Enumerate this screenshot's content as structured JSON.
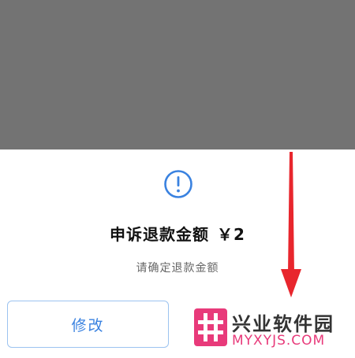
{
  "dialog": {
    "title": "申诉退款金额",
    "amount": "￥2",
    "subtitle": "请确定退款金额",
    "icon": "exclamation-circle-icon",
    "modify_label": "修改"
  },
  "watermark": {
    "name": "兴业软件园",
    "domain": "MYXYJS.COM"
  },
  "colors": {
    "overlay": "#737373",
    "accent": "#3a82e0",
    "annotation_arrow": "#e8262d",
    "watermark_pink": "#e83a7a"
  }
}
